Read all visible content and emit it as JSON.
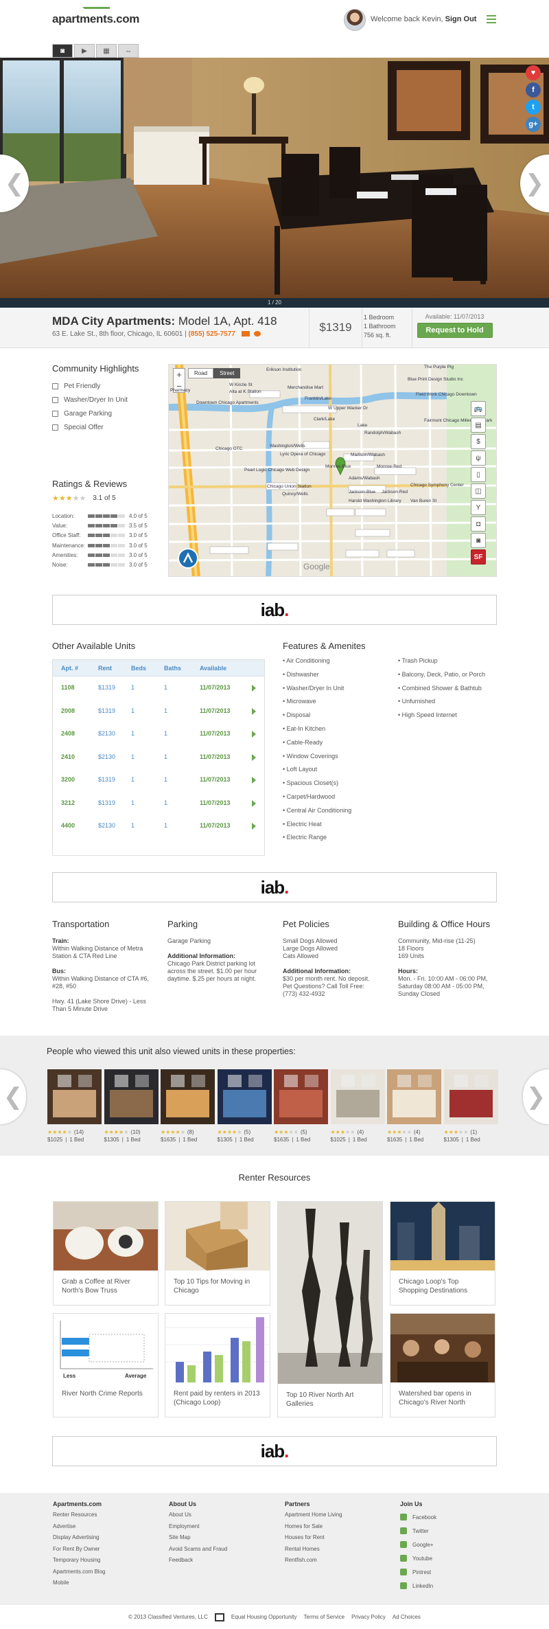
{
  "header": {
    "logo": "apartments.com",
    "welcome_prefix": "Welcome back",
    "user_name": "Kevin,",
    "sign_out": "Sign Out"
  },
  "photo_counter": "1 / 20",
  "listing": {
    "name": "MDA City Apartments:",
    "unit": "Model 1A, Apt. 418",
    "address": "63 E. Lake St., 8th floor, Chicago, IL 60601",
    "separator": "|",
    "phone": "(855) 525-7577",
    "price": "$1319",
    "bedrooms": "1 Bedroom",
    "bathrooms": "1 Bathroom",
    "size": "756 sq. ft.",
    "available": "Available: 11/07/2013",
    "hold_button": "Request to Hold"
  },
  "highlights": {
    "title": "Community Highlights",
    "items": [
      "Pet Friendly",
      "Washer/Dryer In Unit",
      "Garage Parking",
      "Special Offer"
    ]
  },
  "ratings": {
    "title": "Ratings & Reviews",
    "overall": "3.1 of 5",
    "overall_value": 3.1,
    "rows": [
      {
        "label": "Location:",
        "value": "4.0 of 5"
      },
      {
        "label": "Value:",
        "value": "3.5 of 5"
      },
      {
        "label": "Office Staff:",
        "value": "3.0 of 5"
      },
      {
        "label": "Maintenance:",
        "value": "3.0 of 5"
      },
      {
        "label": "Amenities:",
        "value": "3.0 of 5"
      },
      {
        "label": "Noise:",
        "value": "3.0 of 5"
      }
    ]
  },
  "map": {
    "zoom_in": "+",
    "zoom_out": "−",
    "view_road": "Road",
    "view_street": "Street",
    "attribution": "Google",
    "labels": [
      "Erikson Institution",
      "The Purple Pig",
      "Merchandise Mart",
      "Blue Print Design Studio Inc",
      "Field Work Chicago Downtown",
      "Fairmont Chicago Millennium Park",
      "Clark/Lake",
      "Lake",
      "Randolph/Wabash",
      "Washington/Wells",
      "Lyric Opera of Chicago",
      "Madison/Wabash",
      "Monroe-Blue",
      "Monroe-Red",
      "Adams/Wabash",
      "Chicago Union Station",
      "Quincy/Wells",
      "Jackson-Blue",
      "Jackson-Red",
      "Chicago Symphony Center",
      "Harold Washington Library",
      "Van Buren St",
      "Chicago OTC",
      "Pearl Logic Chicago Web Design",
      "Downtown Chicago Apartments",
      "Alta at K Station",
      "Pharmacy",
      "W Upper Wacker Dr",
      "W Kinzie St",
      "Franklin/Lake"
    ],
    "sf_badge": "SF"
  },
  "ad_text": {
    "main": "iab",
    "dot": "."
  },
  "units": {
    "title": "Other Available Units",
    "headers": [
      "Apt. #",
      "Rent",
      "Beds",
      "Baths",
      "Available"
    ],
    "rows": [
      [
        "1108",
        "$1319",
        "1",
        "1",
        "11/07/2013"
      ],
      [
        "2008",
        "$1319",
        "1",
        "1",
        "11/07/2013"
      ],
      [
        "2408",
        "$2130",
        "1",
        "1",
        "11/07/2013"
      ],
      [
        "2410",
        "$2130",
        "1",
        "1",
        "11/07/2013"
      ],
      [
        "3200",
        "$1319",
        "1",
        "1",
        "11/07/2013"
      ],
      [
        "3212",
        "$1319",
        "1",
        "1",
        "11/07/2013"
      ],
      [
        "4400",
        "$2130",
        "1",
        "1",
        "11/07/2013"
      ]
    ]
  },
  "features": {
    "title": "Features & Amenites",
    "col1": [
      "• Air Conditioning",
      "• Dishwasher",
      "• Washer/Dryer In Unit",
      "• Microwave",
      "• Disposal",
      "• Eat-In Kitchen",
      "• Cable-Ready",
      "• Window Coverings",
      "• Loft Layout",
      "• Spacious Closet(s)",
      "• Carpet/Hardwood",
      "• Central Air Conditioning",
      "• Electric Heat",
      "• Electric Range"
    ],
    "col2": [
      "• Trash Pickup",
      "• Balcony, Deck, Patio, or Porch",
      "• Combined Shower & Bathtub",
      "• Unfurnished",
      "• High Speed Internet"
    ]
  },
  "details": {
    "transportation": {
      "title": "Transportation",
      "train_label": "Train:",
      "train": "Within Walking Distance of Metra Station & CTA Red Line",
      "bus_label": "Bus:",
      "bus": "Within Walking Distance of  CTA #6, #28, #50",
      "hwy": "Hwy. 41 (Lake Shore Drive) - Less Than 5 Minute Drive"
    },
    "parking": {
      "title": "Parking",
      "type": "Garage Parking",
      "info_label": "Additional Information:",
      "info": "Chicago Park District parking lot across the street. $1.00 per hour daytime. $.25 per hours at night."
    },
    "pets": {
      "title": "Pet Policies",
      "allowed": [
        "Small Dogs Allowed",
        "Large Dogs Allowed",
        "Cats Allowed"
      ],
      "info_label": "Additional Information:",
      "info": "$30 per month rent. No deposit. Pet Questions? Call Toll Free: (773) 432-4932"
    },
    "building": {
      "title": "Building & Office Hours",
      "lines": [
        "Community, Mid-rise (11-25)",
        "18 Floors",
        "169 Units"
      ],
      "hours_label": "Hours:",
      "hours": "Mon. - Fri. 10:00 AM - 06:00 PM, Saturday 08:00 AM - 05:00 PM, Sunday Closed"
    }
  },
  "also_viewed": {
    "title": "People who viewed this unit also viewed units in these properties:",
    "items": [
      {
        "stars": 4,
        "count": "(14)",
        "price": "$1025",
        "beds": "1 Bed"
      },
      {
        "stars": 4,
        "count": "(10)",
        "price": "$1305",
        "beds": "1 Bed"
      },
      {
        "stars": 4,
        "count": "(8)",
        "price": "$1635",
        "beds": "1 Bed"
      },
      {
        "stars": 4,
        "count": "(5)",
        "price": "$1305",
        "beds": "1 Bed"
      },
      {
        "stars": 3,
        "count": "(5)",
        "price": "$1635",
        "beds": "1 Bed"
      },
      {
        "stars": 3,
        "count": "(4)",
        "price": "$1025",
        "beds": "1 Bed"
      },
      {
        "stars": 3,
        "count": "(4)",
        "price": "$1635",
        "beds": "1 Bed"
      },
      {
        "stars": 3,
        "count": "(1)",
        "price": "$1305",
        "beds": "1 Bed"
      }
    ]
  },
  "resources": {
    "title": "Renter Resources",
    "items": [
      "Grab a Coffee at River North's Bow Truss",
      "Top 10 Tips for Moving in Chicago",
      "Top 10 River North Art Galleries",
      "Chicago Loop's Top Shopping Destinations",
      "River North Crime Reports",
      "Rent paid by renters in 2013 (Chicago Loop)",
      "Watershed bar opens in Chicago's River North"
    ],
    "crime_less": "Less",
    "crime_avg": "Average"
  },
  "footer": {
    "col1_title": "Apartments.com",
    "col1": [
      "Renter Resources",
      "Advertise",
      "Display Advertising",
      "For Rent By Owner",
      "Temporary Housing",
      "Apartments.com Blog",
      "Mobile"
    ],
    "col2_title": "About Us",
    "col2": [
      "About Us",
      "Employment",
      "Site Map",
      "Avoid Scams and Fraud",
      "Feedback"
    ],
    "col3_title": "Partners",
    "col3": [
      "Apartment Home Living",
      "Homes for Sale",
      "Houses for Rent",
      "Rental Homes",
      "Rentfish.com"
    ],
    "col4_title": "Join Us",
    "col4": [
      "Facebook",
      "Twitter",
      "Google+",
      "Youtube",
      "Pintrest",
      "LinkedIn"
    ],
    "copyright": "© 2013 Classified Ventures, LLC",
    "legal": [
      "Equal Housing Opportunity",
      "Terms of Service",
      "Privacy Policy",
      "Ad Choices"
    ]
  }
}
